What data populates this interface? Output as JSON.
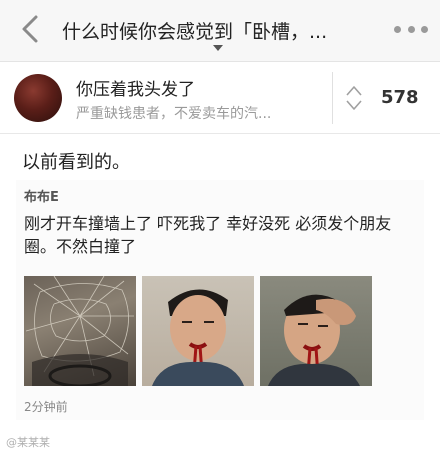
{
  "navbar": {
    "title": "什么时候你会感觉到「卧槽，..."
  },
  "answer": {
    "author_name": "你压着我头发了",
    "author_bio": "严重缺钱患者，不爱卖车的汽...",
    "vote_count": "578",
    "text": "以前看到的。"
  },
  "embedded_post": {
    "username": "布布E",
    "text": "刚才开车撞墙上了 吓死我了 幸好没死 必须发个朋友圈。不然白撞了",
    "time": "2分钟前"
  },
  "watermark": "@某某某",
  "colors": {
    "navbar_bg": "#f7f7f7",
    "text_primary": "#222222",
    "text_secondary": "#9a9a9a"
  },
  "icons": {
    "back": "chevron-left-icon",
    "more": "more-dots-icon",
    "vote": "vote-arrows-icon",
    "title_caret": "caret-down-icon"
  }
}
